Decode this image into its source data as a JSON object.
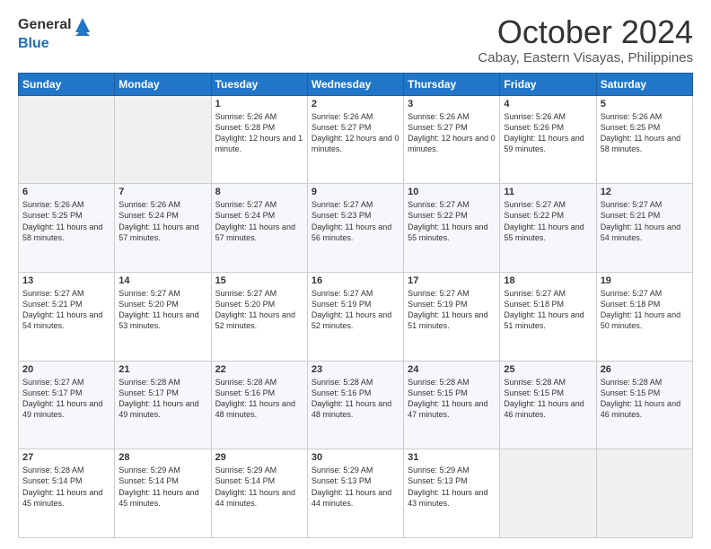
{
  "header": {
    "logo": {
      "line1": "General",
      "line2": "Blue"
    },
    "month": "October 2024",
    "location": "Cabay, Eastern Visayas, Philippines"
  },
  "weekdays": [
    "Sunday",
    "Monday",
    "Tuesday",
    "Wednesday",
    "Thursday",
    "Friday",
    "Saturday"
  ],
  "weeks": [
    [
      {
        "day": "",
        "sunrise": "",
        "sunset": "",
        "daylight": ""
      },
      {
        "day": "",
        "sunrise": "",
        "sunset": "",
        "daylight": ""
      },
      {
        "day": "1",
        "sunrise": "Sunrise: 5:26 AM",
        "sunset": "Sunset: 5:28 PM",
        "daylight": "Daylight: 12 hours and 1 minute."
      },
      {
        "day": "2",
        "sunrise": "Sunrise: 5:26 AM",
        "sunset": "Sunset: 5:27 PM",
        "daylight": "Daylight: 12 hours and 0 minutes."
      },
      {
        "day": "3",
        "sunrise": "Sunrise: 5:26 AM",
        "sunset": "Sunset: 5:27 PM",
        "daylight": "Daylight: 12 hours and 0 minutes."
      },
      {
        "day": "4",
        "sunrise": "Sunrise: 5:26 AM",
        "sunset": "Sunset: 5:26 PM",
        "daylight": "Daylight: 11 hours and 59 minutes."
      },
      {
        "day": "5",
        "sunrise": "Sunrise: 5:26 AM",
        "sunset": "Sunset: 5:25 PM",
        "daylight": "Daylight: 11 hours and 58 minutes."
      }
    ],
    [
      {
        "day": "6",
        "sunrise": "Sunrise: 5:26 AM",
        "sunset": "Sunset: 5:25 PM",
        "daylight": "Daylight: 11 hours and 58 minutes."
      },
      {
        "day": "7",
        "sunrise": "Sunrise: 5:26 AM",
        "sunset": "Sunset: 5:24 PM",
        "daylight": "Daylight: 11 hours and 57 minutes."
      },
      {
        "day": "8",
        "sunrise": "Sunrise: 5:27 AM",
        "sunset": "Sunset: 5:24 PM",
        "daylight": "Daylight: 11 hours and 57 minutes."
      },
      {
        "day": "9",
        "sunrise": "Sunrise: 5:27 AM",
        "sunset": "Sunset: 5:23 PM",
        "daylight": "Daylight: 11 hours and 56 minutes."
      },
      {
        "day": "10",
        "sunrise": "Sunrise: 5:27 AM",
        "sunset": "Sunset: 5:22 PM",
        "daylight": "Daylight: 11 hours and 55 minutes."
      },
      {
        "day": "11",
        "sunrise": "Sunrise: 5:27 AM",
        "sunset": "Sunset: 5:22 PM",
        "daylight": "Daylight: 11 hours and 55 minutes."
      },
      {
        "day": "12",
        "sunrise": "Sunrise: 5:27 AM",
        "sunset": "Sunset: 5:21 PM",
        "daylight": "Daylight: 11 hours and 54 minutes."
      }
    ],
    [
      {
        "day": "13",
        "sunrise": "Sunrise: 5:27 AM",
        "sunset": "Sunset: 5:21 PM",
        "daylight": "Daylight: 11 hours and 54 minutes."
      },
      {
        "day": "14",
        "sunrise": "Sunrise: 5:27 AM",
        "sunset": "Sunset: 5:20 PM",
        "daylight": "Daylight: 11 hours and 53 minutes."
      },
      {
        "day": "15",
        "sunrise": "Sunrise: 5:27 AM",
        "sunset": "Sunset: 5:20 PM",
        "daylight": "Daylight: 11 hours and 52 minutes."
      },
      {
        "day": "16",
        "sunrise": "Sunrise: 5:27 AM",
        "sunset": "Sunset: 5:19 PM",
        "daylight": "Daylight: 11 hours and 52 minutes."
      },
      {
        "day": "17",
        "sunrise": "Sunrise: 5:27 AM",
        "sunset": "Sunset: 5:19 PM",
        "daylight": "Daylight: 11 hours and 51 minutes."
      },
      {
        "day": "18",
        "sunrise": "Sunrise: 5:27 AM",
        "sunset": "Sunset: 5:18 PM",
        "daylight": "Daylight: 11 hours and 51 minutes."
      },
      {
        "day": "19",
        "sunrise": "Sunrise: 5:27 AM",
        "sunset": "Sunset: 5:18 PM",
        "daylight": "Daylight: 11 hours and 50 minutes."
      }
    ],
    [
      {
        "day": "20",
        "sunrise": "Sunrise: 5:27 AM",
        "sunset": "Sunset: 5:17 PM",
        "daylight": "Daylight: 11 hours and 49 minutes."
      },
      {
        "day": "21",
        "sunrise": "Sunrise: 5:28 AM",
        "sunset": "Sunset: 5:17 PM",
        "daylight": "Daylight: 11 hours and 49 minutes."
      },
      {
        "day": "22",
        "sunrise": "Sunrise: 5:28 AM",
        "sunset": "Sunset: 5:16 PM",
        "daylight": "Daylight: 11 hours and 48 minutes."
      },
      {
        "day": "23",
        "sunrise": "Sunrise: 5:28 AM",
        "sunset": "Sunset: 5:16 PM",
        "daylight": "Daylight: 11 hours and 48 minutes."
      },
      {
        "day": "24",
        "sunrise": "Sunrise: 5:28 AM",
        "sunset": "Sunset: 5:15 PM",
        "daylight": "Daylight: 11 hours and 47 minutes."
      },
      {
        "day": "25",
        "sunrise": "Sunrise: 5:28 AM",
        "sunset": "Sunset: 5:15 PM",
        "daylight": "Daylight: 11 hours and 46 minutes."
      },
      {
        "day": "26",
        "sunrise": "Sunrise: 5:28 AM",
        "sunset": "Sunset: 5:15 PM",
        "daylight": "Daylight: 11 hours and 46 minutes."
      }
    ],
    [
      {
        "day": "27",
        "sunrise": "Sunrise: 5:28 AM",
        "sunset": "Sunset: 5:14 PM",
        "daylight": "Daylight: 11 hours and 45 minutes."
      },
      {
        "day": "28",
        "sunrise": "Sunrise: 5:29 AM",
        "sunset": "Sunset: 5:14 PM",
        "daylight": "Daylight: 11 hours and 45 minutes."
      },
      {
        "day": "29",
        "sunrise": "Sunrise: 5:29 AM",
        "sunset": "Sunset: 5:14 PM",
        "daylight": "Daylight: 11 hours and 44 minutes."
      },
      {
        "day": "30",
        "sunrise": "Sunrise: 5:29 AM",
        "sunset": "Sunset: 5:13 PM",
        "daylight": "Daylight: 11 hours and 44 minutes."
      },
      {
        "day": "31",
        "sunrise": "Sunrise: 5:29 AM",
        "sunset": "Sunset: 5:13 PM",
        "daylight": "Daylight: 11 hours and 43 minutes."
      },
      {
        "day": "",
        "sunrise": "",
        "sunset": "",
        "daylight": ""
      },
      {
        "day": "",
        "sunrise": "",
        "sunset": "",
        "daylight": ""
      }
    ]
  ]
}
